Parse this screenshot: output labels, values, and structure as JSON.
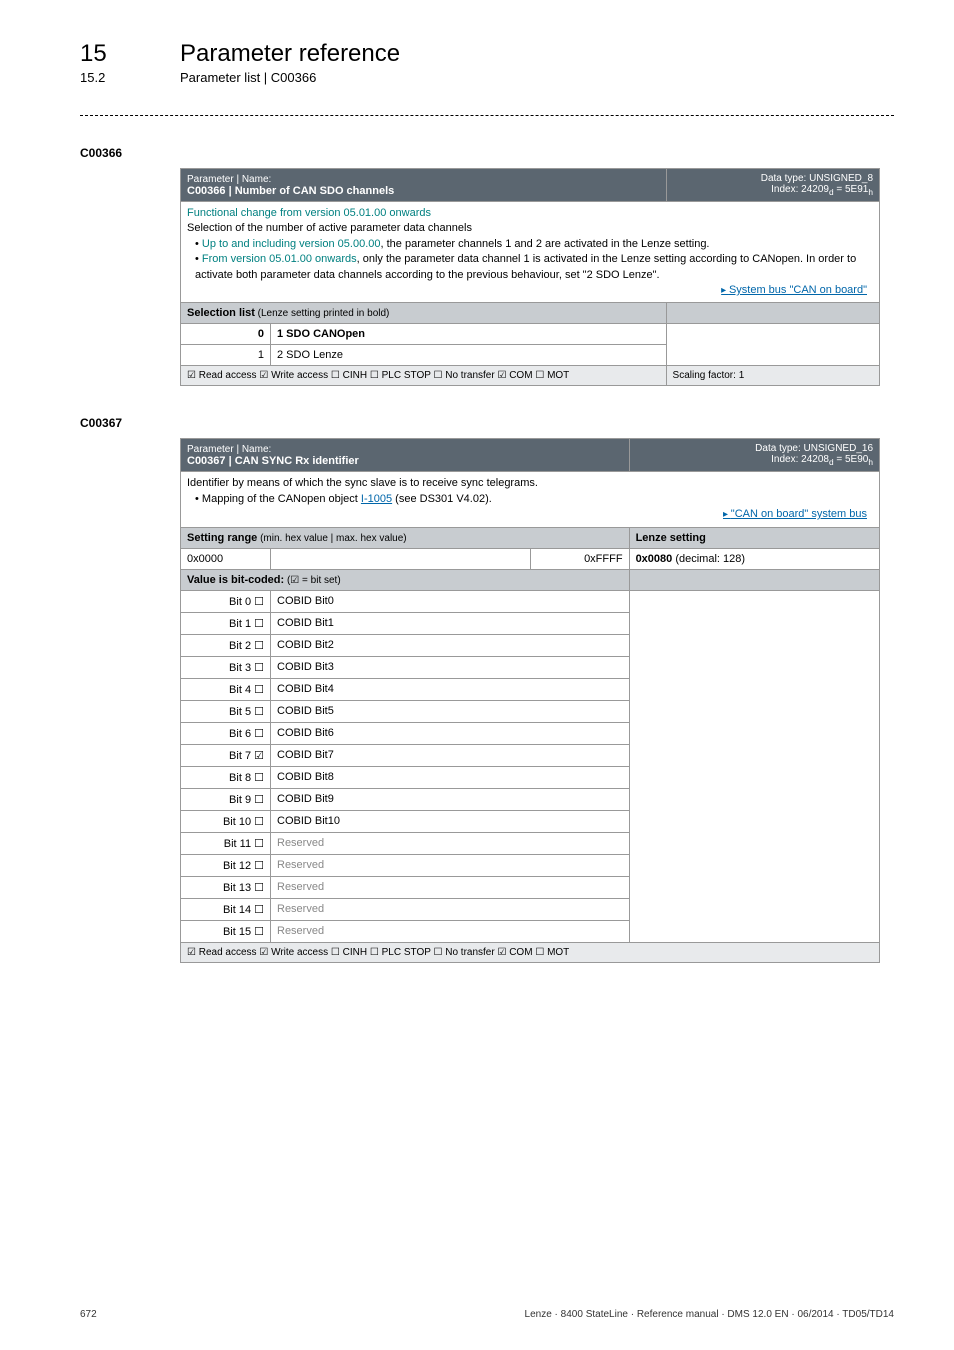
{
  "header": {
    "chapter_num": "15",
    "chapter_title": "Parameter reference",
    "section_num": "15.2",
    "section_title": "Parameter list | C00366"
  },
  "block1": {
    "code": "C00366",
    "pn_label": "Parameter | Name:",
    "pn_title": "C00366 | Number of CAN SDO channels",
    "type1": "Data type: UNSIGNED_8",
    "type2": "Index: 24209",
    "type2_sub1": "d",
    "type2_mid": " = 5E91",
    "type2_sub2": "h",
    "desc_l1": "Functional change from version 05.01.00 onwards",
    "desc_l2": "Selection of the number of active parameter data channels",
    "desc_b1a": "Up to and including version 05.00.00",
    "desc_b1b": ", the parameter channels 1 and 2 are activated in the Lenze setting.",
    "desc_b2a": "From version 05.01.00 onwards",
    "desc_b2b": ", only the parameter data channel 1 is activated in the Lenze setting according to CANopen. In order to activate both parameter data channels according to the previous behaviour, set \"2 SDO Lenze\".",
    "desc_link": "System bus \"CAN on board\"",
    "sel_head": "Selection list",
    "sel_head_note": " (Lenze setting printed in bold)",
    "sel_0_k": "0",
    "sel_0_v": "1 SDO CANOpen",
    "sel_1_k": "1",
    "sel_1_v": "2 SDO Lenze",
    "footer_a": "☑ Read access   ☑ Write access   ☐ CINH   ☐ PLC STOP   ☐ No transfer   ☑ COM   ☐ MOT",
    "footer_b": "Scaling factor: 1"
  },
  "block2": {
    "code": "C00367",
    "pn_label": "Parameter | Name:",
    "pn_title": "C00367 | CAN SYNC Rx identifier",
    "type1": "Data type: UNSIGNED_16",
    "type2": "Index: 24208",
    "type2_sub1": "d",
    "type2_mid": " = 5E90",
    "type2_sub2": "h",
    "desc_l1": "Identifier by means of which the sync slave is to receive sync telegrams.",
    "desc_b1_pre": "Mapping of the CANopen object ",
    "desc_b1_link": "I-1005",
    "desc_b1_post": " (see DS301 V4.02).",
    "desc_link": "\"CAN on board\" system bus",
    "range_head": "Setting range",
    "range_head_note": " (min. hex value | max. hex value)",
    "lenze_head": "Lenze setting",
    "range_min": "0x0000",
    "range_max": "0xFFFF",
    "lenze_val": "0x0080",
    "lenze_val_note": "  (decimal: 128)",
    "bitset_head": "Value is bit-coded:",
    "bitset_note": "  (☑ = bit set)",
    "bits": [
      {
        "k": "Bit 0  ☐",
        "v": "COBID Bit0"
      },
      {
        "k": "Bit 1  ☐",
        "v": "COBID Bit1"
      },
      {
        "k": "Bit 2  ☐",
        "v": "COBID Bit2"
      },
      {
        "k": "Bit 3  ☐",
        "v": "COBID Bit3"
      },
      {
        "k": "Bit 4  ☐",
        "v": "COBID Bit4"
      },
      {
        "k": "Bit 5  ☐",
        "v": "COBID Bit5"
      },
      {
        "k": "Bit 6  ☐",
        "v": "COBID Bit6"
      },
      {
        "k": "Bit 7  ☑",
        "v": "COBID Bit7"
      },
      {
        "k": "Bit 8  ☐",
        "v": "COBID Bit8"
      },
      {
        "k": "Bit 9  ☐",
        "v": "COBID Bit9"
      },
      {
        "k": "Bit 10  ☐",
        "v": "COBID Bit10"
      },
      {
        "k": "Bit 11  ☐",
        "v": "Reserved",
        "grey": true
      },
      {
        "k": "Bit 12  ☐",
        "v": "Reserved",
        "grey": true
      },
      {
        "k": "Bit 13  ☐",
        "v": "Reserved",
        "grey": true
      },
      {
        "k": "Bit 14  ☐",
        "v": "Reserved",
        "grey": true
      },
      {
        "k": "Bit 15  ☐",
        "v": "Reserved",
        "grey": true
      }
    ],
    "footer_a": "☑ Read access   ☑ Write access   ☐ CINH   ☐ PLC STOP   ☐ No transfer   ☑ COM   ☐ MOT"
  },
  "footer": {
    "page": "672",
    "doc": "Lenze · 8400 StateLine · Reference manual · DMS 12.0 EN · 06/2014 · TD05/TD14"
  }
}
